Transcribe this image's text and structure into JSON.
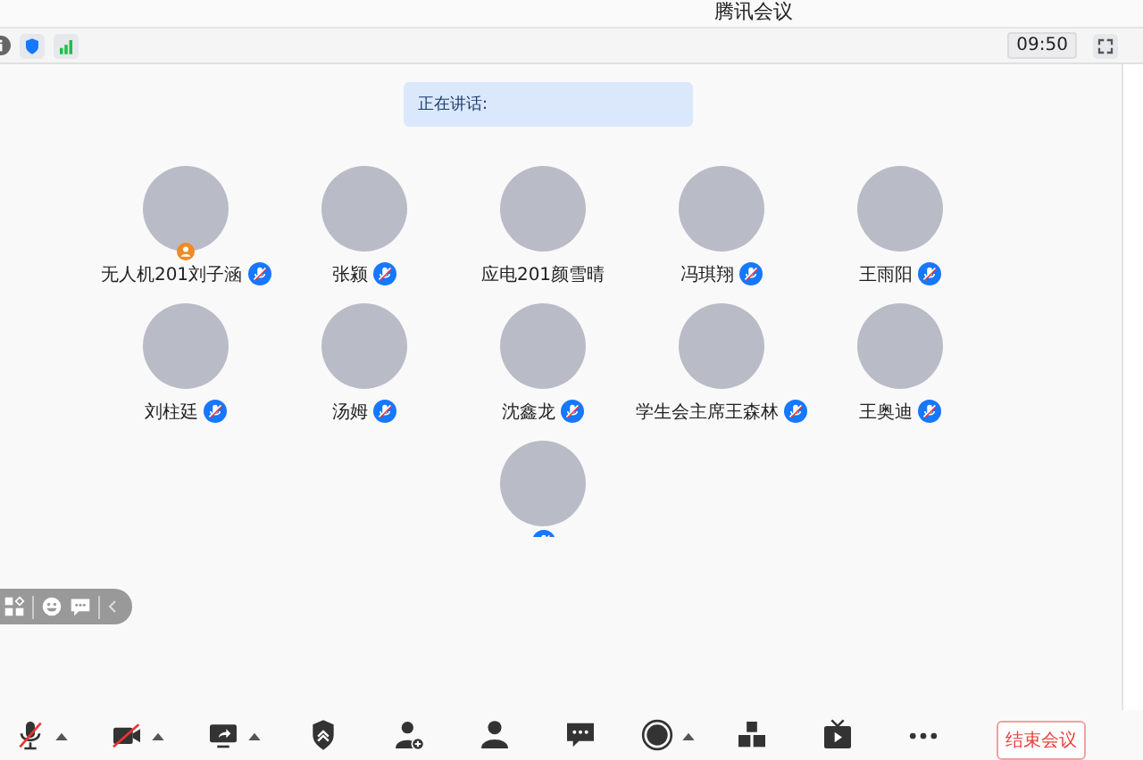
{
  "window": {
    "title": "腾讯会议"
  },
  "top_bar": {
    "time": "09:50"
  },
  "speaking": {
    "label": "正在讲话:"
  },
  "participants": [
    {
      "name": "无人机201刘子涵",
      "host": true,
      "mic_muted": true
    },
    {
      "name": "张颍",
      "host": false,
      "mic_muted": true
    },
    {
      "name": "应电201颜雪晴",
      "host": false,
      "mic_muted": false
    },
    {
      "name": "冯琪翔",
      "host": false,
      "mic_muted": true
    },
    {
      "name": "王雨阳",
      "host": false,
      "mic_muted": true
    },
    {
      "name": "刘柱廷",
      "host": false,
      "mic_muted": true
    },
    {
      "name": "汤姆",
      "host": false,
      "mic_muted": true
    },
    {
      "name": "沈鑫龙",
      "host": false,
      "mic_muted": true
    },
    {
      "name": "学生会主席王森林",
      "host": false,
      "mic_muted": true
    },
    {
      "name": "王奥迪",
      "host": false,
      "mic_muted": true
    },
    {
      "host": false,
      "mic_muted": true
    }
  ],
  "toolbar": [
    {
      "kind": "mic-off",
      "caret": true
    },
    {
      "kind": "camera-off",
      "caret": true
    },
    {
      "kind": "share",
      "caret": true
    },
    {
      "kind": "security",
      "caret": false
    },
    {
      "kind": "invite",
      "caret": false
    },
    {
      "kind": "members",
      "caret": false
    },
    {
      "kind": "chat",
      "caret": false
    },
    {
      "kind": "record",
      "caret": true
    },
    {
      "kind": "breakout",
      "caret": false
    },
    {
      "kind": "live",
      "caret": false
    },
    {
      "kind": "more",
      "caret": false
    }
  ],
  "end_button": "结束会议"
}
